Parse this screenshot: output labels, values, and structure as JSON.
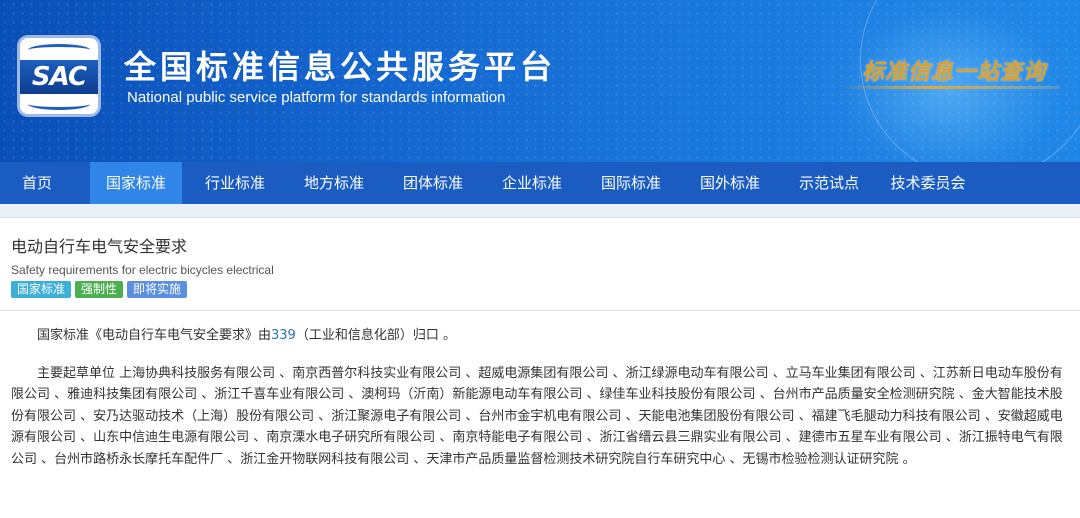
{
  "header": {
    "logo_text": "SAC",
    "title_cn": "全国标准信息公共服务平台",
    "title_en": "National public service platform  for standards information",
    "slogan": "标准信息一站查询",
    "colors": {
      "brand_blue": "#1a5cc2",
      "nav_active": "#2f85e8",
      "slogan_gold": "#d9a030"
    }
  },
  "nav": {
    "items": [
      {
        "label": "首页"
      },
      {
        "label": "国家标准"
      },
      {
        "label": "行业标准"
      },
      {
        "label": "地方标准"
      },
      {
        "label": "团体标准"
      },
      {
        "label": "企业标准"
      },
      {
        "label": "国际标准"
      },
      {
        "label": "国外标准"
      },
      {
        "label": "示范试点"
      },
      {
        "label": "技术委员会"
      }
    ],
    "active": "国家标准"
  },
  "standard": {
    "title": "电动自行车电气安全要求",
    "title_en": "Safety requirements for electric bicycles electrical",
    "badges": [
      "国家标准",
      "强制性",
      "即将实施"
    ]
  },
  "content": {
    "p1_prefix": "国家标准《电动自行车电气安全要求》由",
    "p1_link": "339",
    "p1_suffix": "（工业和信息化部）归口 。",
    "p2": "主要起草单位 上海协典科技服务有限公司 、南京西普尔科技实业有限公司 、超威电源集团有限公司 、浙江绿源电动车有限公司 、立马车业集团有限公司 、江苏新日电动车股份有限公司 、雅迪科技集团有限公司 、浙江千喜车业有限公司 、澳柯玛（沂南）新能源电动车有限公司 、绿佳车业科技股份有限公司 、台州市产品质量安全检测研究院 、金大智能技术股份有限公司 、安乃达驱动技术（上海）股份有限公司 、浙江聚源电子有限公司 、台州市金宇机电有限公司 、天能电池集团股份有限公司 、福建飞毛腿动力科技有限公司 、安徽超威电源有限公司 、山东中信迪生电源有限公司 、南京溧水电子研究所有限公司 、南京特能电子有限公司 、浙江省缙云县三鼎实业有限公司 、建德市五星车业有限公司 、浙江振特电气有限公司 、台州市路桥永长摩托车配件厂 、浙江金开物联网科技有限公司 、天津市产品质量监督检测技术研究院自行车研究中心 、无锡市检验检测认证研究院 。"
  }
}
